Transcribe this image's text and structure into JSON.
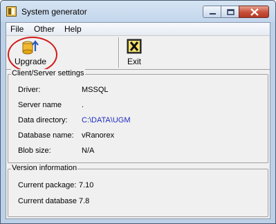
{
  "window": {
    "title": "System generator"
  },
  "menu": {
    "file": "File",
    "other": "Other",
    "help": "Help"
  },
  "toolbar": {
    "upgrade_label": "Upgrade",
    "exit_label": "Exit"
  },
  "client_server": {
    "title": "Client/Server settings",
    "rows": [
      {
        "label": "Driver:",
        "value": "MSSQL"
      },
      {
        "label": "Server name",
        "value": "."
      },
      {
        "label": "Data directory:",
        "value": "C:\\DATA\\UGM"
      },
      {
        "label": "Database name:",
        "value": "vRanorex"
      },
      {
        "label": "Blob size:",
        "value": "N/A"
      }
    ]
  },
  "version": {
    "title": "Version information",
    "rows": [
      {
        "label": "Current package:",
        "value": "7.10"
      },
      {
        "label": "Current database",
        "value": "7.8"
      }
    ]
  },
  "colors": {
    "link_value": "#1e2bbf",
    "highlight_ring": "#d21919"
  }
}
